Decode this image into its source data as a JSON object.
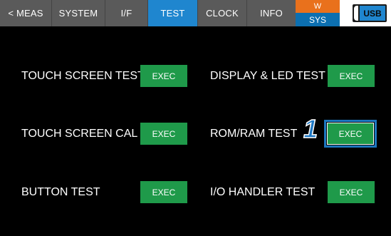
{
  "tabs": {
    "meas": "< MEAS",
    "system": "SYSTEM",
    "if": "I/F",
    "test": "TEST",
    "clock": "CLOCK",
    "info": "INFO"
  },
  "status": {
    "w": "W",
    "sys": "SYS",
    "usb": "USB"
  },
  "tests": [
    {
      "label": "TOUCH SCREEN TEST",
      "button": "EXEC"
    },
    {
      "label": "DISPLAY & LED TEST",
      "button": "EXEC"
    },
    {
      "label": "TOUCH SCREEN CAL",
      "button": "EXEC"
    },
    {
      "label": "ROM/RAM TEST",
      "button": "EXEC"
    },
    {
      "label": "BUTTON TEST",
      "button": "EXEC"
    },
    {
      "label": "I/O HANDLER TEST",
      "button": "EXEC"
    }
  ],
  "callout": "1",
  "colors": {
    "active_tab": "#1f86cf",
    "exec_button": "#1f9a4a",
    "w_indicator": "#e9711c",
    "sys_indicator": "#0c6fb0"
  }
}
